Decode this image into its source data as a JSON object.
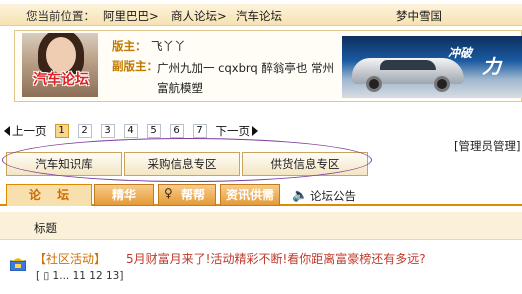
{
  "breadcrumb": {
    "label": "您当前位置：",
    "items": [
      "阿里巴巴>",
      "商人论坛>",
      "汽车论坛"
    ],
    "user": "梦中雪国"
  },
  "forum": {
    "logo_text": "汽车论坛",
    "moderator_label": "版主：",
    "moderator_name": "飞丫丫",
    "submoderator_label": "副版主：",
    "submoderator_names": "广州九加一 cqxbrq 醉翁亭也 常州富航模塑"
  },
  "banner": {
    "text_1": "冲破",
    "text_2": "力"
  },
  "pager": {
    "prev_label": "上一页",
    "pages": [
      "1",
      "2",
      "3",
      "4",
      "5",
      "6",
      "7"
    ],
    "current_page": "1",
    "next_label": "下一页"
  },
  "admin_link": "[管理员管理]",
  "categories": [
    "汽车知识库",
    "采购信息专区",
    "供货信息专区"
  ],
  "tabs": {
    "forum": "论 坛",
    "elite": "精华",
    "help": "帮帮",
    "supply": "资讯供需",
    "announcement": "论坛公告"
  },
  "topic_list": {
    "header": "标题",
    "topics": [
      {
        "tag": "【社区活动】",
        "title": "5月财富月来了!活动精彩不断!看你距离富豪榜还有多远?",
        "pages": "[ ▯ 1... 11 12 13]"
      }
    ]
  },
  "colors": {
    "accent_orange": "#e08a00",
    "ring_purple": "#7b3b9e",
    "title_red": "#c0392b",
    "label_gold": "#c07a00"
  }
}
